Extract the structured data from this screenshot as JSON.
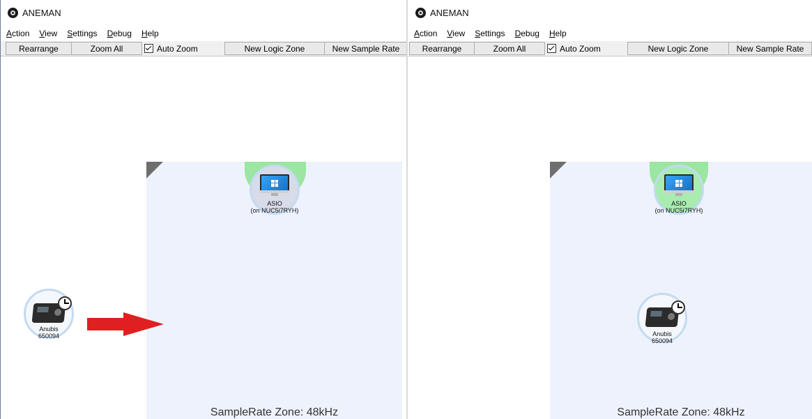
{
  "app": {
    "title": "ANEMAN"
  },
  "menu": [
    {
      "underline": "A",
      "rest": "ction"
    },
    {
      "underline": "V",
      "rest": "iew"
    },
    {
      "underline": "S",
      "rest": "ettings"
    },
    {
      "underline": "D",
      "rest": "ebug"
    },
    {
      "underline": "H",
      "rest": "elp"
    }
  ],
  "toolbar": {
    "rearrange": "Rearrange",
    "zoom_all": "Zoom All",
    "auto_zoom": "Auto Zoom",
    "new_logic_zone": "New Logic Zone",
    "new_sample_rate": "New Sample Rate"
  },
  "zone": {
    "label": "SampleRate Zone: 48kHz"
  },
  "nodes": {
    "asio": {
      "line1": "ASIO",
      "line2": "(on NUC5i7RYH)"
    },
    "anubis": {
      "line1": "Anubis",
      "line2": "650094"
    }
  },
  "colors": {
    "zone_bg": "#edf2fc",
    "node_ring": "#c3daf1",
    "green_highlight": "#9be6a0",
    "arrow": "#e02020"
  },
  "icons": [
    "app-icon",
    "windows-pc-icon",
    "audio-interface-icon",
    "clock-icon",
    "right-arrow-icon"
  ]
}
